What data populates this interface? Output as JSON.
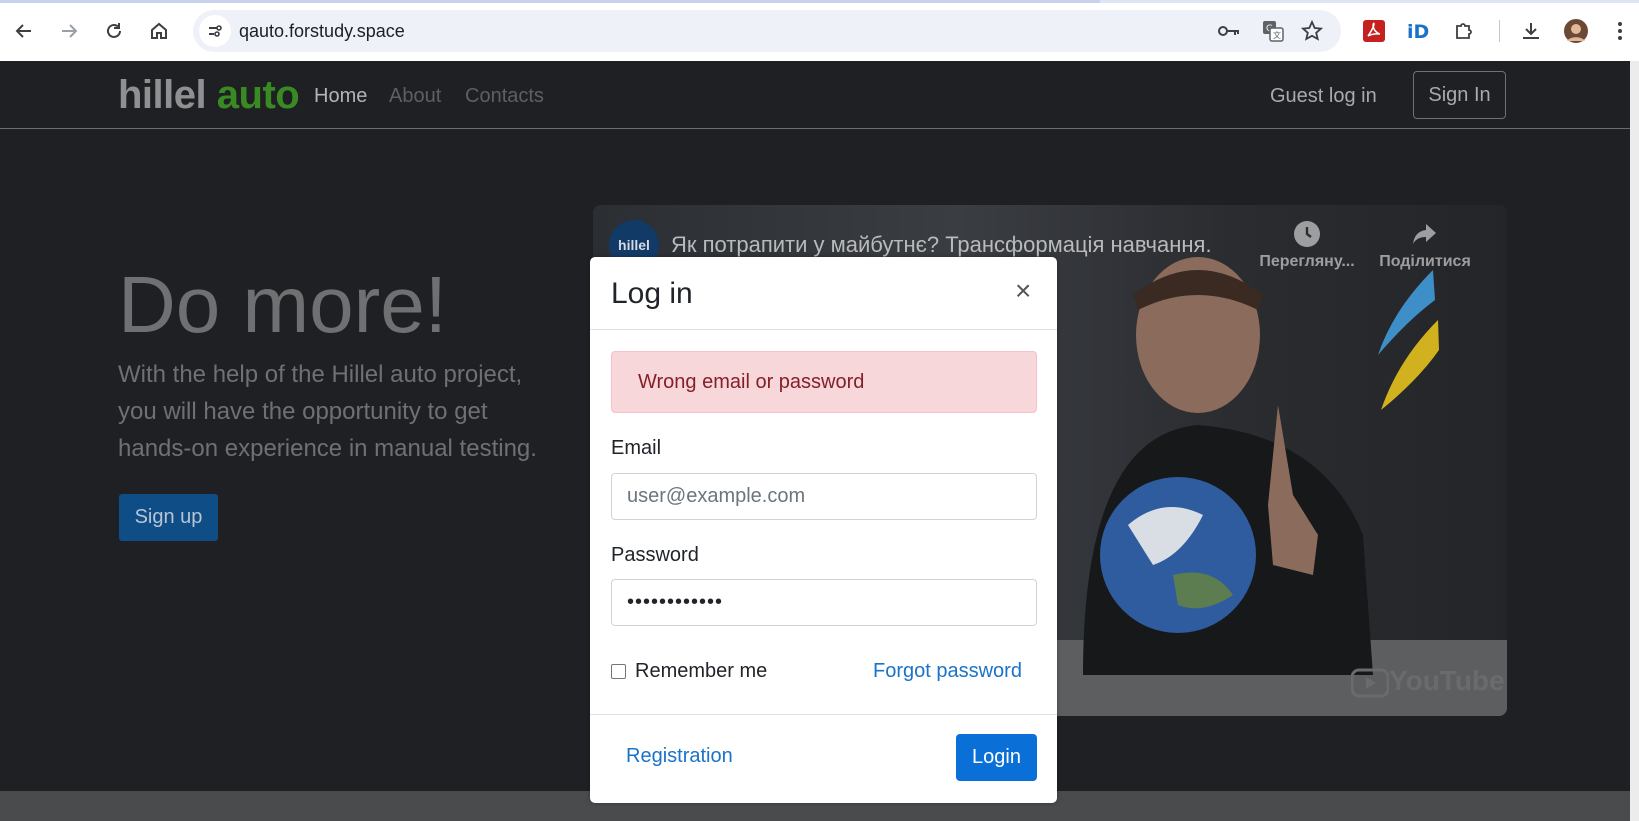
{
  "browser": {
    "url": "qauto.forstudy.space",
    "icons": [
      "back-icon",
      "forward-icon",
      "reload-icon",
      "home-icon",
      "site-info-icon",
      "key-icon",
      "translate-icon",
      "star-icon",
      "pdf-extension-icon",
      "id-extension-icon",
      "extensions-icon",
      "download-icon",
      "profile-avatar",
      "menu-icon"
    ]
  },
  "header": {
    "logo_hillel": "hillel",
    "logo_auto": "auto",
    "nav": [
      "Home",
      "About",
      "Contacts"
    ],
    "guest_login": "Guest log in",
    "sign_in": "Sign In"
  },
  "hero": {
    "title": "Do more!",
    "text": "With the help of the Hillel auto project, you will have the opportunity to get hands-on experience in manual testing.",
    "signup": "Sign up"
  },
  "video": {
    "channel": "hillel",
    "title": "Як потрапити у майбутнє? Трансформація навчання.",
    "watch_later": "Перегляну...",
    "share": "Поділитися",
    "platform": "YouTube"
  },
  "modal": {
    "title": "Log in",
    "close": "×",
    "error": "Wrong email or password",
    "email_label": "Email",
    "email_placeholder": "user@example.com",
    "password_label": "Password",
    "password_value": "••••••••••••",
    "remember": "Remember me",
    "forgot": "Forgot password",
    "registration": "Registration",
    "login": "Login"
  },
  "colors": {
    "accent": "#0b6fd8",
    "logo_green": "#3a8a24",
    "error_bg": "#f8d7da",
    "error_text": "#842029"
  }
}
